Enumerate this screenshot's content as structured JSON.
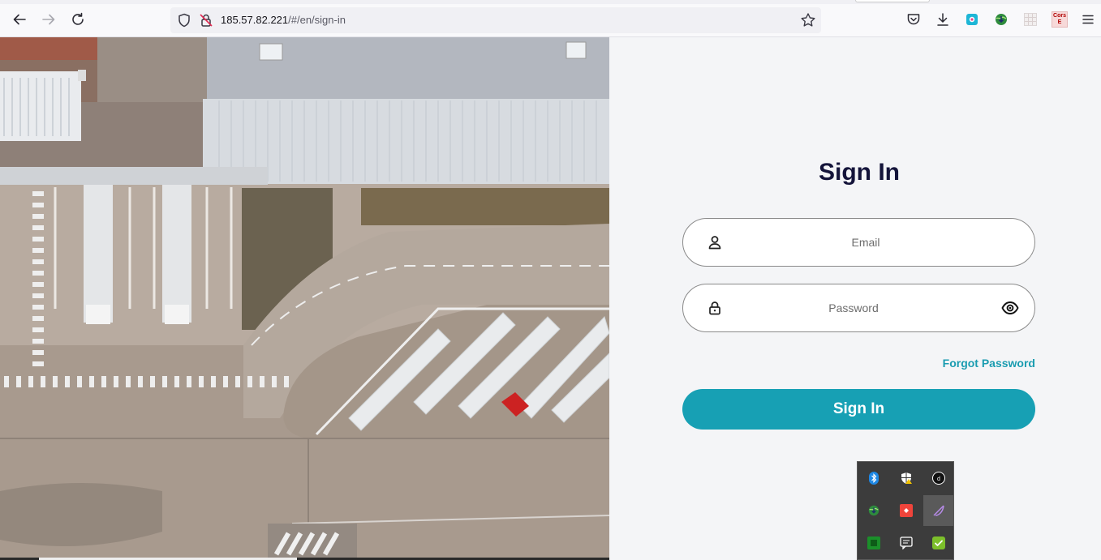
{
  "browser": {
    "url_host": "185.57.82.221",
    "url_path": "/#/en/sign-in",
    "ext_cors_label_top": "Cors",
    "ext_cors_label_bottom": "E"
  },
  "signin": {
    "title": "Sign In",
    "email_placeholder": "Email",
    "password_placeholder": "Password",
    "forgot_label": "Forgot Password",
    "submit_label": "Sign In"
  },
  "colors": {
    "accent": "#17a0b4",
    "title": "#14143a",
    "link": "#1a9cb0"
  },
  "icons": {
    "back": "arrow-left-icon",
    "forward": "arrow-right-icon",
    "reload": "reload-icon",
    "shield": "shield-icon",
    "lock": "lock-slash-icon",
    "bookmark": "star-icon",
    "pocket": "pocket-icon",
    "downloads": "download-icon",
    "user": "user-icon",
    "password": "padlock-icon",
    "eye": "eye-icon",
    "menu": "hamburger-icon"
  }
}
